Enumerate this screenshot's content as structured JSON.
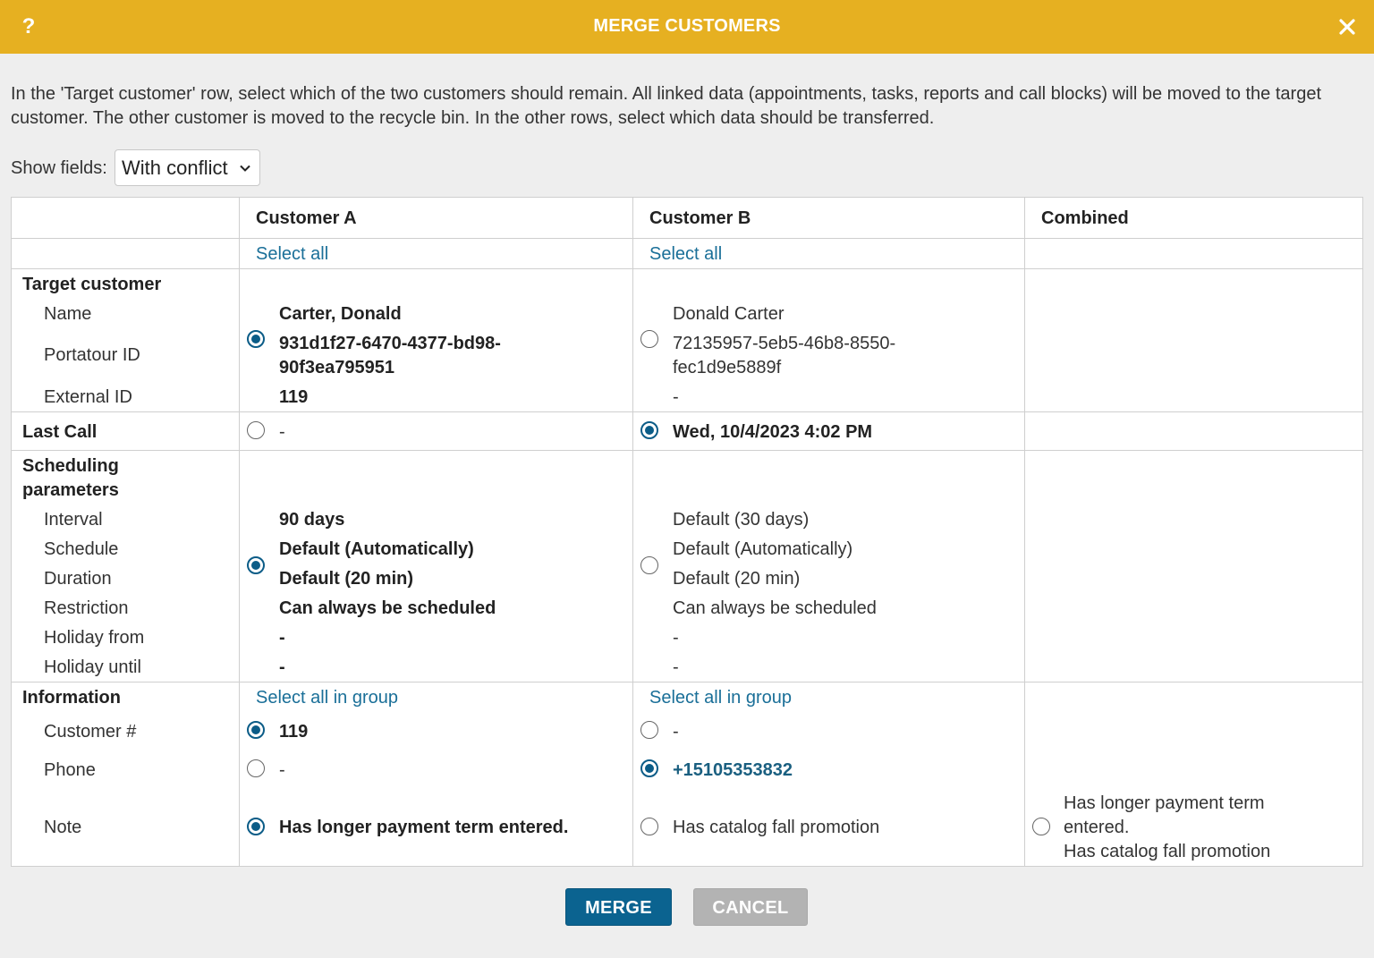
{
  "dialog": {
    "help_label": "?",
    "title": "MERGE CUSTOMERS",
    "intro": "In the 'Target customer' row, select which of the two customers should remain. All linked data (appointments, tasks, reports and call blocks) will be moved to the target customer. The other customer is moved to the recycle bin. In the other rows, select which data should be transferred."
  },
  "filter": {
    "label": "Show fields:",
    "selected": "With conflict"
  },
  "table": {
    "headers": {
      "a": "Customer A",
      "b": "Customer B",
      "combined": "Combined"
    },
    "select_all": "Select all",
    "select_all_group": "Select all in group",
    "target": {
      "label": "Target customer",
      "fields": {
        "name": "Name",
        "portatour_id": "Portatour ID",
        "external_id": "External ID"
      },
      "a": {
        "name": "Carter, Donald",
        "portatour_id_1": "931d1f27-6470-4377-bd98-",
        "portatour_id_2": "90f3ea795951",
        "external_id": "119",
        "selected": true
      },
      "b": {
        "name": "Donald Carter",
        "portatour_id_1": "72135957-5eb5-46b8-8550-",
        "portatour_id_2": "fec1d9e5889f",
        "external_id": "-",
        "selected": false
      }
    },
    "last_call": {
      "label": "Last Call",
      "a": {
        "value": "-",
        "selected": false
      },
      "b": {
        "value": "Wed, 10/4/2023 4:02 PM",
        "selected": true
      }
    },
    "scheduling": {
      "label_1": "Scheduling",
      "label_2": "parameters",
      "fields": {
        "interval": "Interval",
        "schedule": "Schedule",
        "duration": "Duration",
        "restriction": "Restriction",
        "holiday_from": "Holiday from",
        "holiday_until": "Holiday until"
      },
      "a": {
        "interval": "90 days",
        "schedule": "Default (Automatically)",
        "duration": "Default (20 min)",
        "restriction": "Can always be scheduled",
        "holiday_from": "-",
        "holiday_until": "-",
        "selected": true
      },
      "b": {
        "interval": "Default (30 days)",
        "schedule": "Default (Automatically)",
        "duration": "Default (20 min)",
        "restriction": "Can always be scheduled",
        "holiday_from": "-",
        "holiday_until": "-",
        "selected": false
      }
    },
    "information": {
      "label": "Information",
      "customer_no": {
        "label": "Customer #",
        "a": "119",
        "b": "-",
        "selected": "a"
      },
      "phone": {
        "label": "Phone",
        "a": "-",
        "b": "+15105353832",
        "selected": "b"
      },
      "note": {
        "label": "Note",
        "a": "Has longer payment term entered.",
        "b": "Has catalog fall promotion",
        "combined_1": "Has longer payment term",
        "combined_2": "entered.",
        "combined_3": "Has catalog fall promotion",
        "selected": "a"
      }
    }
  },
  "actions": {
    "merge": "MERGE",
    "cancel": "CANCEL"
  },
  "colors": {
    "titlebar": "#e6b021",
    "primary": "#0b6390",
    "link": "#1a6f98",
    "disabled": "#b3b3b3"
  }
}
